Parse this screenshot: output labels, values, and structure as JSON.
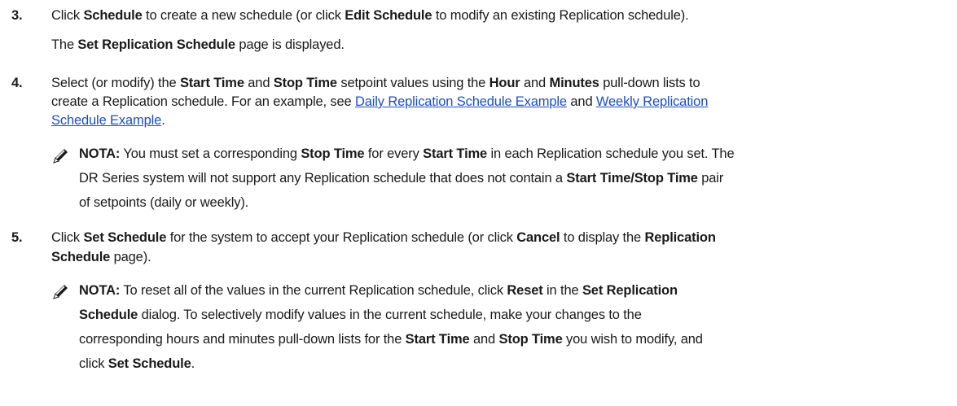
{
  "step3": {
    "num": "3.",
    "click": "Click ",
    "schedule": "Schedule",
    "mid": " to create a new schedule (or click ",
    "edit_schedule": "Edit Schedule",
    "end": " to modify an existing Replication schedule).",
    "result_pre": "The ",
    "result_bold": "Set Replication Schedule",
    "result_post": " page is displayed."
  },
  "step4": {
    "num": "4.",
    "l1_a": "Select (or modify) the ",
    "l1_start": "Start Time",
    "l1_and": " and ",
    "l1_stop": "Stop Time",
    "l1_b": " setpoint values using the ",
    "l1_hour": "Hour",
    "l1_and2": " and ",
    "l1_minutes": "Minutes",
    "l1_c": " pull-down lists to",
    "l2_a": "create a Replication schedule. For an example, see ",
    "l2_link1": "Daily Replication Schedule Example",
    "l2_and": " and ",
    "l2_link2a": "Weekly Replication",
    "l3_link2b": "Schedule Example",
    "l3_end": ".",
    "note": {
      "label": "NOTA:",
      "l1_a": " You must set a corresponding ",
      "l1_stop": "Stop Time",
      "l1_b": " for every ",
      "l1_start": "Start Time",
      "l1_c": " in each Replication schedule you set. The",
      "l2_a": "DR Series system will not support any Replication schedule that does not contain a ",
      "l2_pair": "Start Time/Stop Time",
      "l2_b": " pair",
      "l3": "of setpoints (daily or weekly)."
    }
  },
  "step5": {
    "num": "5.",
    "l1_a": "Click ",
    "l1_set": "Set Schedule",
    "l1_b": " for the system to accept your Replication schedule (or click ",
    "l1_cancel": "Cancel",
    "l1_c": " to display the ",
    "l1_repl": "Replication",
    "l2_sched": "Schedule",
    "l2_end": " page).",
    "note": {
      "label": "NOTA:",
      "l1_a": " To reset all of the values in the current Replication schedule, click ",
      "l1_reset": "Reset",
      "l1_b": " in the ",
      "l1_set_repl": "Set Replication",
      "l2_sched": "Schedule",
      "l2_a": " dialog. To selectively modify values in the current schedule, make your changes to the",
      "l3_a": "corresponding hours and minutes pull-down lists for the ",
      "l3_start": "Start Time",
      "l3_and": " and ",
      "l3_stop": "Stop Time",
      "l3_b": " you wish to modify, and",
      "l4_a": "click ",
      "l4_set": "Set Schedule",
      "l4_end": "."
    }
  },
  "icons": {
    "note_icon": "pencil-note-icon"
  },
  "colors": {
    "link": "#1a4ec8",
    "text": "#1a1a1a"
  }
}
